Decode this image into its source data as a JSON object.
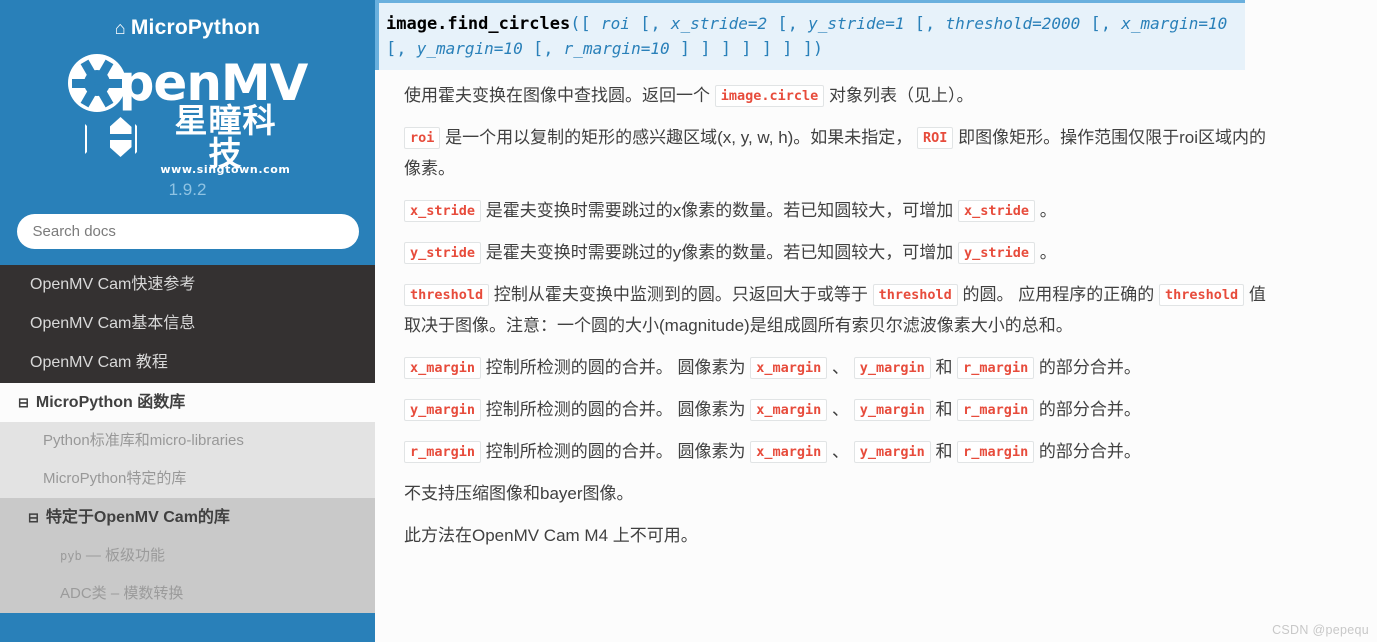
{
  "sidebar": {
    "brand": "MicroPython",
    "home_icon": "⌂",
    "logo": {
      "wordmark": "penMV",
      "cn_name": "星瞳科技",
      "url": "www.singtown.com"
    },
    "version": "1.9.2",
    "search_placeholder": "Search docs",
    "nav": [
      {
        "label": "OpenMV Cam快速参考",
        "level": 1,
        "current": false,
        "icon": ""
      },
      {
        "label": "OpenMV Cam基本信息",
        "level": 1,
        "current": false,
        "icon": ""
      },
      {
        "label": "OpenMV Cam 教程",
        "level": 1,
        "current": false,
        "icon": ""
      },
      {
        "label": "MicroPython 函数库",
        "level": 1,
        "current": true,
        "icon": "⊟"
      },
      {
        "label": "Python标准库和micro-libraries",
        "level": 2,
        "current": false,
        "icon": ""
      },
      {
        "label": "MicroPython特定的库",
        "level": 2,
        "current": false,
        "icon": ""
      },
      {
        "label": "特定于OpenMV Cam的库",
        "level": 2,
        "current": true,
        "icon": "⊟"
      },
      {
        "label": "pyb — 板级功能",
        "level": 3,
        "current": false,
        "icon": "",
        "mono_prefix": "pyb",
        "mono_rest": " — 板级功能"
      },
      {
        "label": "ADC类 – 模数转换",
        "level": 3,
        "current": false,
        "icon": ""
      }
    ]
  },
  "content": {
    "signature": {
      "name": "image.find_circles",
      "open_paren": "(",
      "tokens": [
        {
          "t": "[ ",
          "k": "brk"
        },
        {
          "t": "roi",
          "k": "param"
        },
        {
          "t": " [",
          "k": "brk"
        },
        {
          "t": ", ",
          "k": "brk"
        },
        {
          "t": "x_stride=2",
          "k": "param"
        },
        {
          "t": " [",
          "k": "brk"
        },
        {
          "t": ", ",
          "k": "brk"
        },
        {
          "t": "y_stride=1",
          "k": "param"
        },
        {
          "t": " [",
          "k": "brk"
        },
        {
          "t": ", ",
          "k": "brk"
        },
        {
          "t": "threshold=2000",
          "k": "param"
        },
        {
          "t": " [",
          "k": "brk"
        },
        {
          "t": ", ",
          "k": "brk"
        },
        {
          "t": "x_margin=10",
          "k": "param"
        },
        {
          "t": " [",
          "k": "brk"
        },
        {
          "t": ", ",
          "k": "brk"
        },
        {
          "t": "y_margin=10",
          "k": "param"
        },
        {
          "t": " [",
          "k": "brk"
        },
        {
          "t": ", ",
          "k": "brk"
        },
        {
          "t": "r_margin=10",
          "k": "param"
        },
        {
          "t": " ] ] ] ] ] ] ])",
          "k": "brk"
        }
      ]
    },
    "paragraphs": [
      {
        "id": "p-intro",
        "runs": [
          {
            "t": "使用霍夫变换在图像中查找圆。返回一个 ",
            "c": false
          },
          {
            "t": "image.circle",
            "c": true
          },
          {
            "t": " 对象列表（见上）。",
            "c": false
          }
        ]
      },
      {
        "id": "p-roi",
        "runs": [
          {
            "t": "roi",
            "c": true
          },
          {
            "t": " 是一个用以复制的矩形的感兴趣区域(x, y, w, h)。如果未指定， ",
            "c": false
          },
          {
            "t": "ROI",
            "c": true
          },
          {
            "t": " 即图像矩形。操作范围仅限于roi区域内的像素。",
            "c": false
          }
        ]
      },
      {
        "id": "p-xstride",
        "runs": [
          {
            "t": "x_stride",
            "c": true
          },
          {
            "t": " 是霍夫变换时需要跳过的x像素的数量。若已知圆较大，可增加 ",
            "c": false
          },
          {
            "t": "x_stride",
            "c": true
          },
          {
            "t": " 。",
            "c": false
          }
        ]
      },
      {
        "id": "p-ystride",
        "runs": [
          {
            "t": "y_stride",
            "c": true
          },
          {
            "t": " 是霍夫变换时需要跳过的y像素的数量。若已知圆较大，可增加 ",
            "c": false
          },
          {
            "t": "y_stride",
            "c": true
          },
          {
            "t": " 。",
            "c": false
          }
        ]
      },
      {
        "id": "p-threshold",
        "runs": [
          {
            "t": "threshold",
            "c": true
          },
          {
            "t": " 控制从霍夫变换中监测到的圆。只返回大于或等于 ",
            "c": false
          },
          {
            "t": "threshold",
            "c": true
          },
          {
            "t": " 的圆。 应用程序的正确的 ",
            "c": false
          },
          {
            "t": "threshold",
            "c": true
          },
          {
            "t": " 值取决于图像。注意：一个圆的大小(magnitude)是组成圆所有索贝尔滤波像素大小的总和。",
            "c": false
          }
        ]
      },
      {
        "id": "p-xmargin",
        "runs": [
          {
            "t": "x_margin",
            "c": true
          },
          {
            "t": " 控制所检测的圆的合并。 圆像素为 ",
            "c": false
          },
          {
            "t": "x_margin",
            "c": true
          },
          {
            "t": " 、 ",
            "c": false
          },
          {
            "t": "y_margin",
            "c": true
          },
          {
            "t": " 和 ",
            "c": false
          },
          {
            "t": "r_margin",
            "c": true
          },
          {
            "t": " 的部分合并。",
            "c": false
          }
        ]
      },
      {
        "id": "p-ymargin",
        "runs": [
          {
            "t": "y_margin",
            "c": true
          },
          {
            "t": " 控制所检测的圆的合并。 圆像素为 ",
            "c": false
          },
          {
            "t": "x_margin",
            "c": true
          },
          {
            "t": " 、 ",
            "c": false
          },
          {
            "t": "y_margin",
            "c": true
          },
          {
            "t": " 和 ",
            "c": false
          },
          {
            "t": "r_margin",
            "c": true
          },
          {
            "t": " 的部分合并。",
            "c": false
          }
        ]
      },
      {
        "id": "p-rmargin",
        "runs": [
          {
            "t": "r_margin",
            "c": true
          },
          {
            "t": " 控制所检测的圆的合并。 圆像素为 ",
            "c": false
          },
          {
            "t": "x_margin",
            "c": true
          },
          {
            "t": " 、 ",
            "c": false
          },
          {
            "t": "y_margin",
            "c": true
          },
          {
            "t": " 和 ",
            "c": false
          },
          {
            "t": "r_margin",
            "c": true
          },
          {
            "t": " 的部分合并。",
            "c": false
          }
        ]
      },
      {
        "id": "p-nocompressed",
        "runs": [
          {
            "t": "不支持压缩图像和bayer图像。",
            "c": false
          }
        ]
      },
      {
        "id": "p-m4",
        "runs": [
          {
            "t": "此方法在OpenMV Cam M4 上不可用。",
            "c": false
          }
        ]
      }
    ],
    "watermark": "CSDN @pepequ"
  },
  "colors": {
    "sidebar_blue": "#2980b9",
    "nav_dark": "#343131",
    "code_red": "#e74c3c",
    "sig_bg": "#e7f2fa",
    "sig_border": "#6ab0de"
  }
}
